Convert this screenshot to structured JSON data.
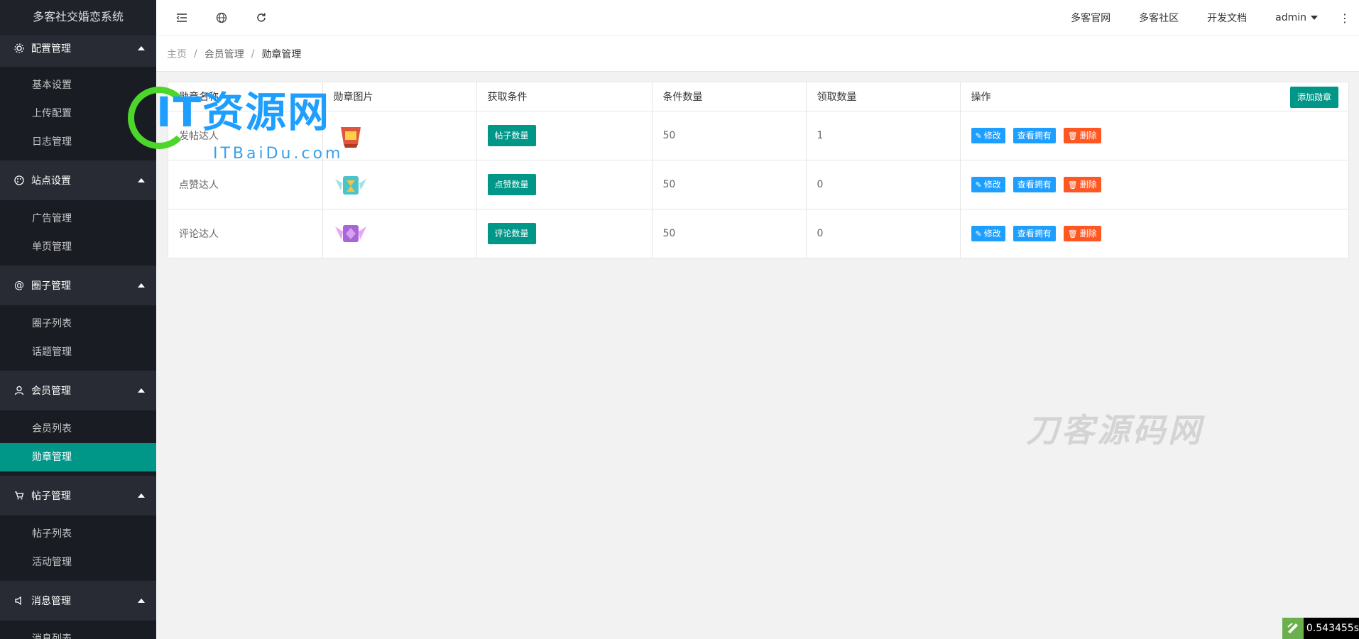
{
  "app": {
    "title": "多客社交婚恋系统"
  },
  "sidebar": {
    "groups": [
      {
        "label": "配置管理",
        "icon": "gear-icon",
        "items": [
          "基本设置",
          "上传配置",
          "日志管理"
        ]
      },
      {
        "label": "站点设置",
        "icon": "palette-icon",
        "items": [
          "广告管理",
          "单页管理"
        ]
      },
      {
        "label": "圈子管理",
        "icon": "at-icon",
        "items": [
          "圈子列表",
          "话题管理"
        ]
      },
      {
        "label": "会员管理",
        "icon": "user-icon",
        "items": [
          "会员列表",
          "勋章管理"
        ]
      },
      {
        "label": "帖子管理",
        "icon": "cart-icon",
        "items": [
          "帖子列表",
          "活动管理"
        ]
      },
      {
        "label": "消息管理",
        "icon": "speaker-icon",
        "items": [
          "消息列表"
        ]
      }
    ],
    "active_item": "勋章管理"
  },
  "header": {
    "links": [
      "多客官网",
      "多客社区",
      "开发文档"
    ],
    "user": "admin",
    "more": "⋮"
  },
  "breadcrumb": {
    "items": [
      "主页",
      "会员管理",
      "勋章管理"
    ],
    "separator": "/"
  },
  "table": {
    "columns": [
      "勋章名称",
      "勋章图片",
      "获取条件",
      "条件数量",
      "领取数量",
      "操作"
    ],
    "add_button": "添加勋章",
    "rows": [
      {
        "name": "发帖达人",
        "badge_color": "#e0563a",
        "condition": "帖子数量",
        "condition_count": "50",
        "received": "1"
      },
      {
        "name": "点赞达人",
        "badge_color": "#4cc3c9",
        "condition": "点赞数量",
        "condition_count": "50",
        "received": "0"
      },
      {
        "name": "评论达人",
        "badge_color": "#a865d8",
        "condition": "评论数量",
        "condition_count": "50",
        "received": "0"
      }
    ],
    "actions": {
      "edit": "修改",
      "view": "查看拥有",
      "delete": "删除"
    }
  },
  "watermarks": {
    "it_main": "IT资源网",
    "it_sub": "ITBaiDu.com",
    "gray": "刀客源码网"
  },
  "timer": {
    "value": "0.543455s"
  },
  "colors": {
    "primary": "#009688",
    "blue": "#1e9fff",
    "red": "#ff5722",
    "sidebar": "#20222a"
  }
}
